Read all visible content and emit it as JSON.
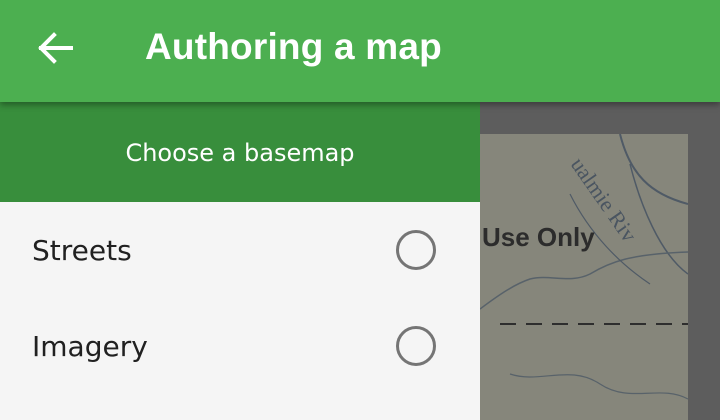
{
  "appbar": {
    "title": "Authoring a map",
    "back_icon": "arrow-back-icon",
    "color": "#4caf50"
  },
  "drawer": {
    "header": "Choose a basemap",
    "header_color": "#388e3c",
    "options": [
      {
        "label": "Streets",
        "selected": false
      },
      {
        "label": "Imagery",
        "selected": false
      }
    ]
  },
  "map": {
    "overlay_text": "Use Only",
    "river_label": "ualmie Riv"
  }
}
